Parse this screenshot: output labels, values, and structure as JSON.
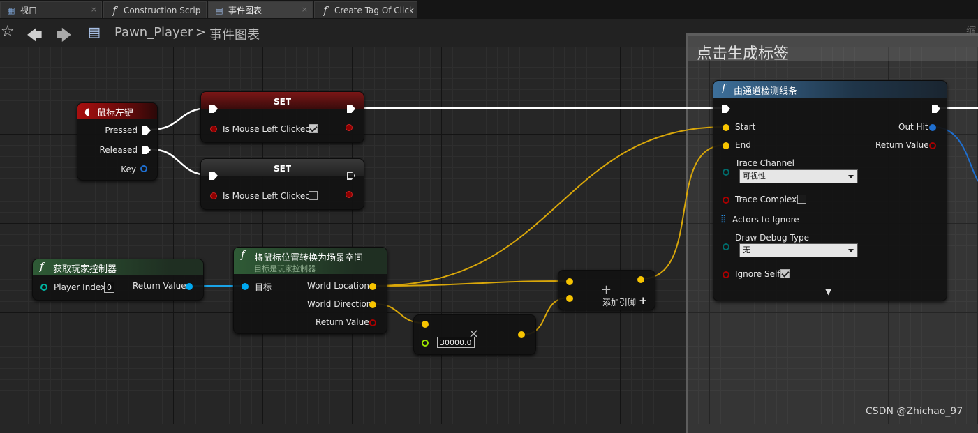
{
  "tabs": [
    {
      "label": "视口",
      "close": "×"
    },
    {
      "label": "Construction Scrip",
      "close": "×"
    },
    {
      "label": "事件图表",
      "close": "×"
    },
    {
      "label": "Create Tag Of Click",
      "close": ""
    }
  ],
  "breadcrumb": {
    "blueprint": "Pawn_Player",
    "separator": ">",
    "graph": "事件图表"
  },
  "comment": {
    "title": "点击生成标签",
    "right_label": "缩"
  },
  "nodes": {
    "mouse": {
      "title": "鼠标左键",
      "pins": [
        "Pressed",
        "Released",
        "Key"
      ]
    },
    "set1": {
      "title": "SET",
      "var": "Is Mouse Left Clicked",
      "checked": true
    },
    "set2": {
      "title": "SET",
      "var": "Is Mouse Left Clicked",
      "checked": false
    },
    "getpc": {
      "title": "获取玩家控制器",
      "player_index_label": "Player Index",
      "player_index": "0",
      "return": "Return Value"
    },
    "deproject": {
      "title": "将鼠标位置转换为场景空间",
      "subtitle": "目标是玩家控制器",
      "target": "目标",
      "out1": "World Location",
      "out2": "World Direction",
      "out3": "Return Value"
    },
    "multiply": {
      "symbol": "×",
      "value": "30000.0"
    },
    "add": {
      "symbol": "+",
      "add_pin": "添加引脚",
      "add_icon": "+"
    },
    "trace": {
      "title": "由通道检测线条",
      "start": "Start",
      "end": "End",
      "channel_label": "Trace Channel",
      "channel_value": "可视性",
      "complex_label": "Trace Complex",
      "complex_checked": false,
      "actors_label": "Actors to Ignore",
      "debug_label": "Draw Debug Type",
      "debug_value": "无",
      "ignore_self_label": "Ignore Self",
      "ignore_self_checked": true,
      "out_hit": "Out Hit",
      "return": "Return Value",
      "expand": "▼"
    }
  },
  "colors": {
    "exec": "#ffffff",
    "vector": "#f7c400",
    "struct": "#1e8ae6",
    "bool": "#8e0000",
    "object": "#00a8f0",
    "byte": "#006b6b",
    "float": "#9ae300"
  },
  "watermark": "CSDN @Zhichao_97"
}
